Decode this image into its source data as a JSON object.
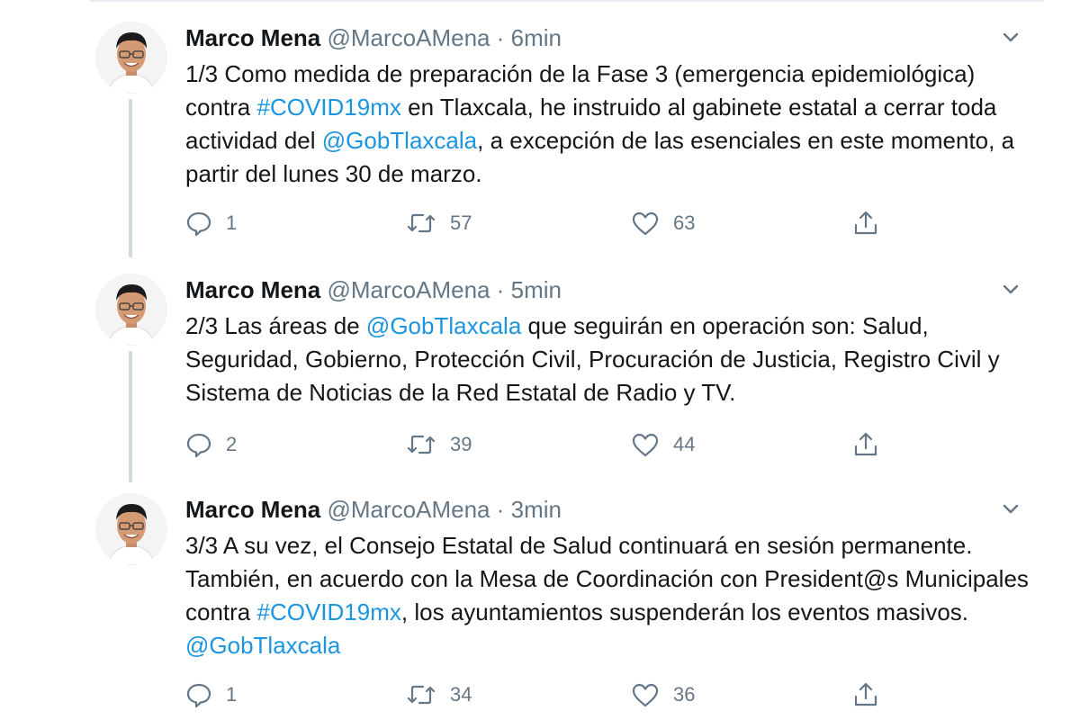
{
  "tweets": [
    {
      "name": "Marco Mena",
      "handle": "@MarcoAMena",
      "separator": "·",
      "time": "6min",
      "text_parts": [
        {
          "t": "1/3 Como medida de preparación de la Fase 3 (emergencia epidemiológica) contra "
        },
        {
          "t": "#COVID19mx",
          "link": true
        },
        {
          "t": " en Tlaxcala, he instruido al gabinete estatal a cerrar toda actividad del "
        },
        {
          "t": "@GobTlaxcala",
          "link": true
        },
        {
          "t": ", a excepción de las esenciales en este momento, a partir del lunes 30 de marzo."
        }
      ],
      "replies": "1",
      "retweets": "57",
      "likes": "63"
    },
    {
      "name": "Marco Mena",
      "handle": "@MarcoAMena",
      "separator": "·",
      "time": "5min",
      "text_parts": [
        {
          "t": "2/3 Las áreas de "
        },
        {
          "t": "@GobTlaxcala",
          "link": true
        },
        {
          "t": " que seguirán en operación son: Salud, Seguridad, Gobierno, Protección Civil, Procuración de Justicia, Registro Civil y Sistema de Noticias de la Red Estatal de Radio y TV."
        }
      ],
      "replies": "2",
      "retweets": "39",
      "likes": "44"
    },
    {
      "name": "Marco Mena",
      "handle": "@MarcoAMena",
      "separator": "·",
      "time": "3min",
      "text_parts": [
        {
          "t": "3/3 A su vez, el Consejo Estatal de Salud continuará en sesión permanente. También, en acuerdo con la Mesa de Coordinación con President@s Municipales contra "
        },
        {
          "t": "#COVID19mx",
          "link": true
        },
        {
          "t": ", los ayuntamientos suspenderán los eventos masivos. "
        },
        {
          "t": "@GobTlaxcala",
          "link": true
        }
      ],
      "replies": "1",
      "retweets": "34",
      "likes": "36"
    }
  ],
  "icons": {
    "reply": "reply-icon",
    "retweet": "retweet-icon",
    "like": "like-icon",
    "share": "share-icon",
    "more": "chevron-down-icon"
  },
  "colors": {
    "link": "#1b95e0",
    "secondary_text": "#657786",
    "thread_line": "#cfd9de"
  }
}
